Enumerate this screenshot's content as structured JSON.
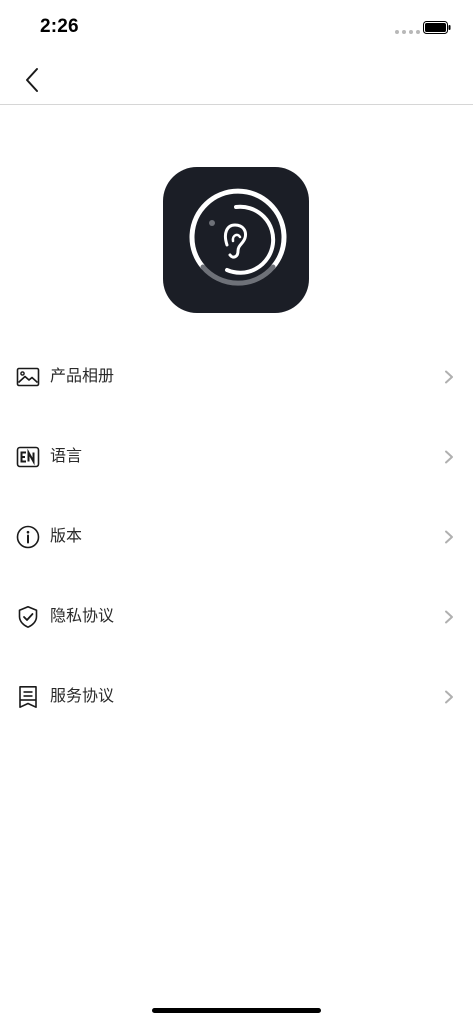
{
  "status_bar": {
    "time": "2:26",
    "battery_icon": "battery-full-icon",
    "signal_icon": "signal-dots-icon"
  },
  "nav": {
    "back_icon": "chevron-left-icon"
  },
  "app_logo": {
    "icon": "ear-hearing-icon",
    "background_color": "#1b1e26"
  },
  "menu": {
    "items": [
      {
        "label": "产品相册",
        "icon": "image-icon"
      },
      {
        "label": "语言",
        "icon": "en-language-icon"
      },
      {
        "label": "版本",
        "icon": "info-circle-icon"
      },
      {
        "label": "隐私协议",
        "icon": "shield-check-icon"
      },
      {
        "label": "服务协议",
        "icon": "document-icon"
      }
    ]
  },
  "colors": {
    "text": "#2a2a2a",
    "chevron": "#b0b0b0",
    "divider": "#d6d6d6"
  }
}
